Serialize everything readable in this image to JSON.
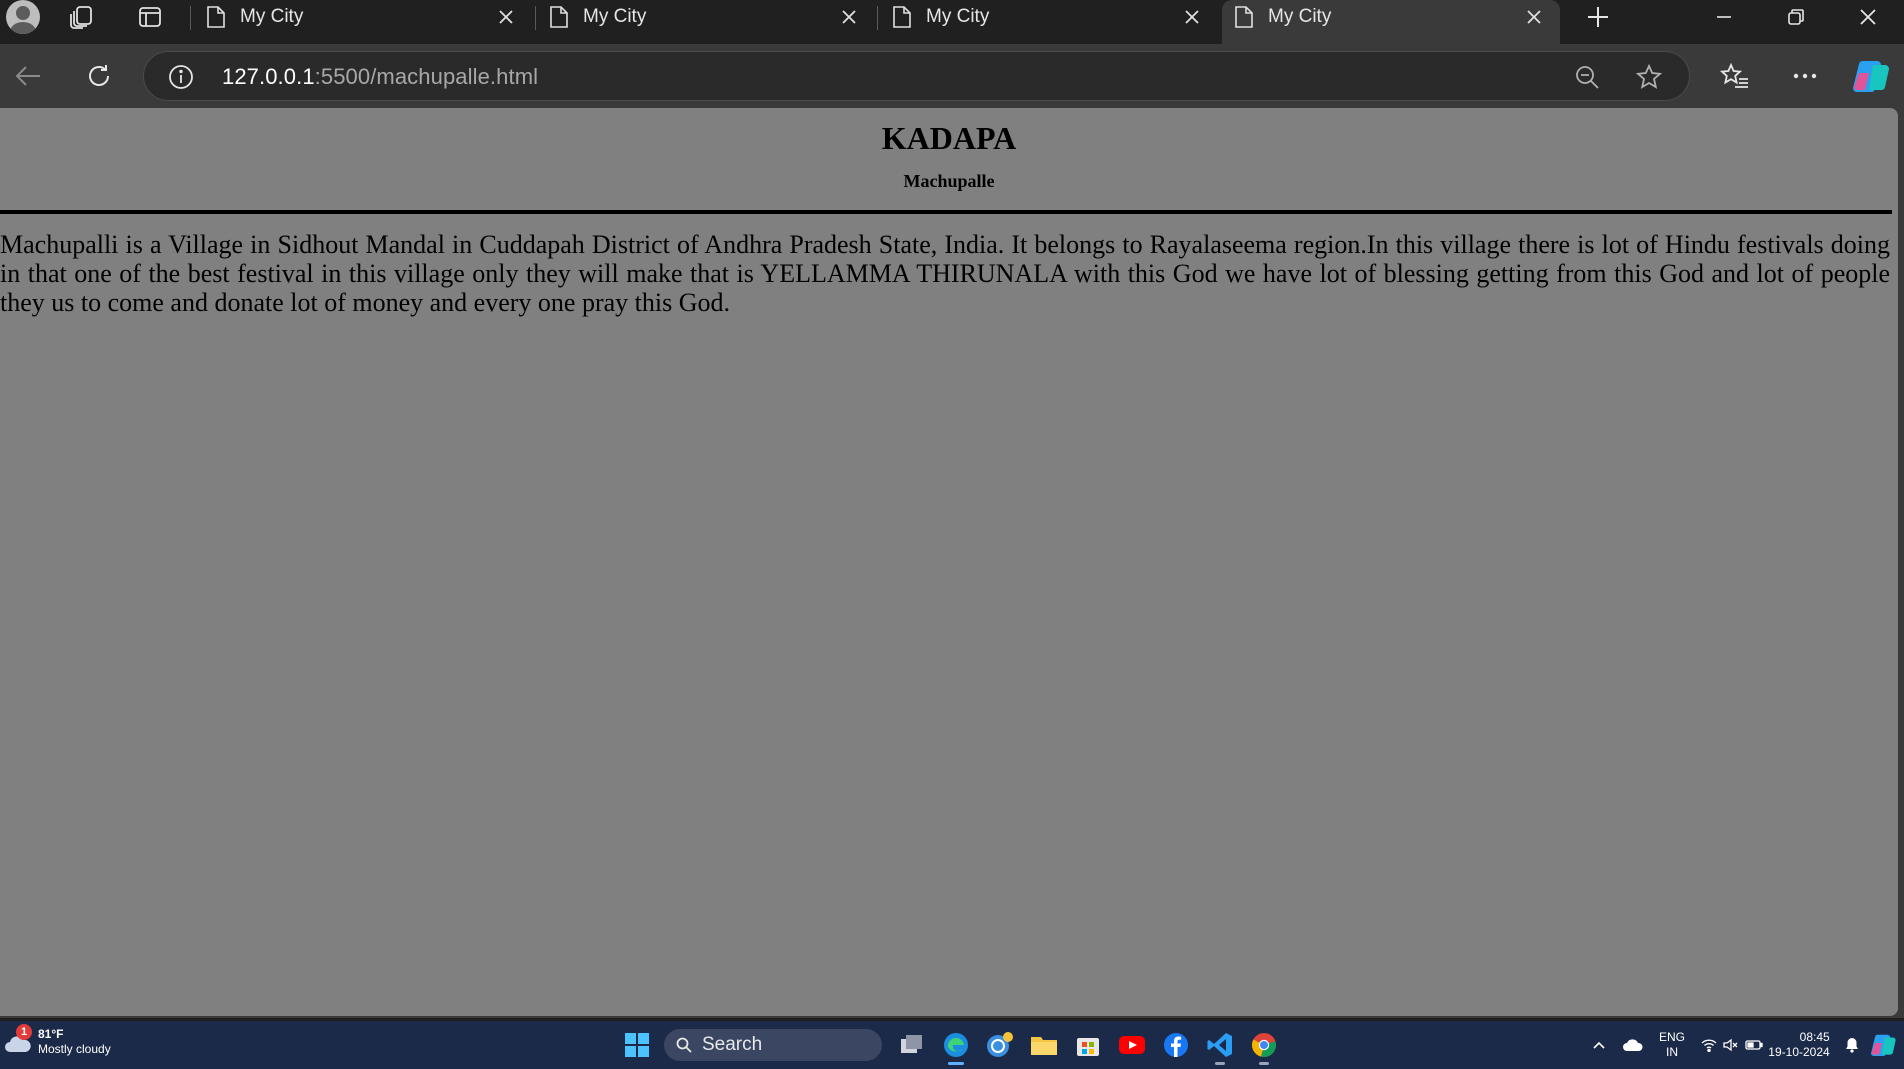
{
  "browser": {
    "tabs": [
      {
        "title": "My City",
        "active": false
      },
      {
        "title": "My City",
        "active": false
      },
      {
        "title": "My City",
        "active": false
      },
      {
        "title": "My City",
        "active": true
      }
    ],
    "url_host": "127.0.0.1",
    "url_rest": ":5500/machupalle.html"
  },
  "page": {
    "heading": "KADAPA",
    "subheading": "Machupalle",
    "paragraph": "Machupalli is a Village in Sidhout Mandal in Cuddapah District of Andhra Pradesh State, India. It belongs to Rayalaseema region.In this village there is lot of Hindu festivals doing in that one of the best festival in this village only they will make that is YELLAMMA THIRUNALA with this God we have lot of blessing getting from this God and lot of people they us to come and donate lot of money and every one pray this God.",
    "background_color": "#808080"
  },
  "taskbar": {
    "weather_badge": "1",
    "weather_temp": "81°F",
    "weather_desc": "Mostly cloudy",
    "search_label": "Search",
    "lang_line1": "ENG",
    "lang_line2": "IN",
    "time": "08:45",
    "date": "19-10-2024"
  },
  "icons": [
    "profile-icon",
    "workspaces-icon",
    "tab-actions-icon",
    "document-icon",
    "close-icon",
    "new-tab-icon",
    "minimize-icon",
    "restore-icon",
    "back-icon",
    "refresh-icon",
    "info-icon",
    "zoom-out-icon",
    "favorite-star-icon",
    "favorites-icon",
    "more-icon",
    "copilot-icon",
    "windows-start-icon",
    "search-icon",
    "task-view-icon",
    "edge-icon",
    "copilot-app-icon",
    "file-explorer-icon",
    "store-icon",
    "youtube-icon",
    "facebook-icon",
    "vscode-icon",
    "chrome-icon",
    "chevron-up-icon",
    "onedrive-icon",
    "wifi-icon",
    "mute-icon",
    "battery-icon",
    "bell-icon"
  ]
}
